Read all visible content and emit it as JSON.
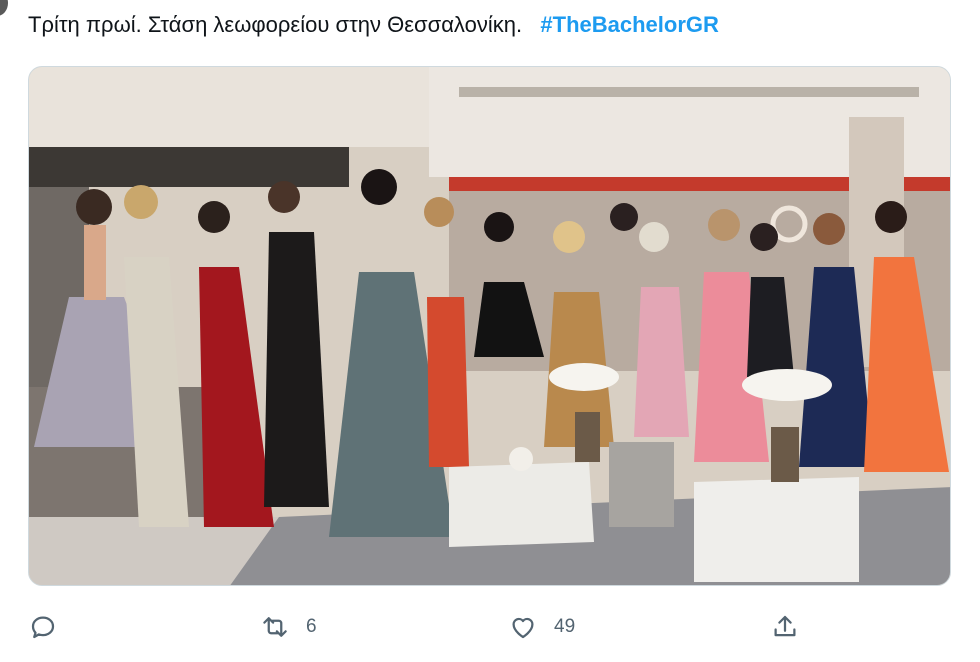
{
  "tweet": {
    "text": "Τρίτη πρωί. Στάση λεωφορείου στην Θεσσαλονίκη.",
    "hashtag": "#TheBachelorGR"
  },
  "media": {
    "alt": "photo"
  },
  "actions": {
    "reply_icon": "comment-bubble-icon",
    "retweet_icon": "retweet-arrows-icon",
    "retweet_count": "6",
    "like_icon": "heart-icon",
    "like_count": "49",
    "share_icon": "share-upload-icon"
  },
  "colors": {
    "hashtag": "#1d9bf0",
    "muted": "#536471"
  }
}
